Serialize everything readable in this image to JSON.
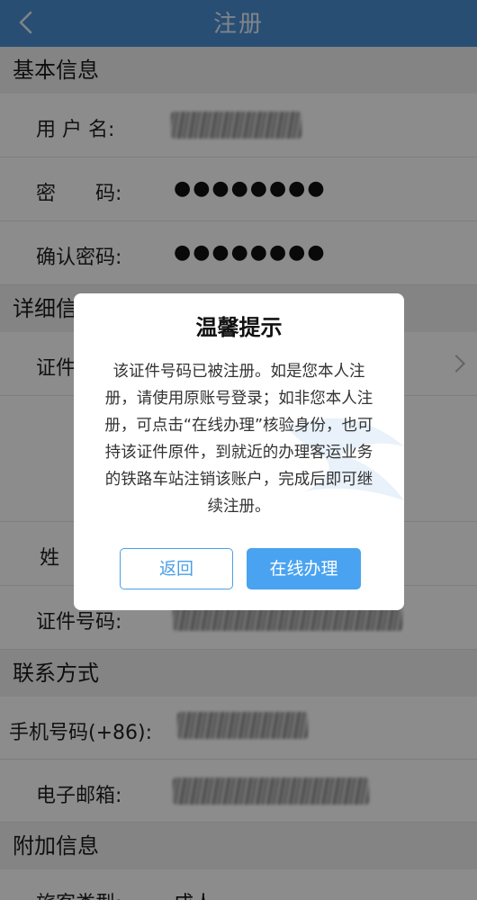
{
  "nav": {
    "title": "注册"
  },
  "basic": {
    "header": "基本信息",
    "username_label": "用 户 名:",
    "password_label": "密　　码:",
    "password_value": "●●●●●●●●",
    "confirm_label": "确认密码:",
    "confirm_value": "●●●●●●●●"
  },
  "detail": {
    "header": "详细信",
    "id_type_label": "证件",
    "surname_label": "姓",
    "id_number_label": "证件号码:"
  },
  "contact": {
    "header": "联系方式",
    "phone_label": "手机号码(+86):",
    "email_label": "电子邮箱:"
  },
  "extra": {
    "header": "附加信息",
    "passenger_label": "旅客类型:",
    "passenger_value": "成人"
  },
  "dialog": {
    "title": "温馨提示",
    "message": "该证件号码已被注册。如是您本人注册，请使用原账号登录；如非您本人注册，可点击“在线办理”核验身份，也可持该证件原件，到就近的办理客运业务的铁路车站注销该账户，完成后即可继续注册。",
    "back_label": "返回",
    "online_label": "在线办理"
  },
  "colors": {
    "nav": "#4a8fd4",
    "accent": "#4aa3f0"
  }
}
